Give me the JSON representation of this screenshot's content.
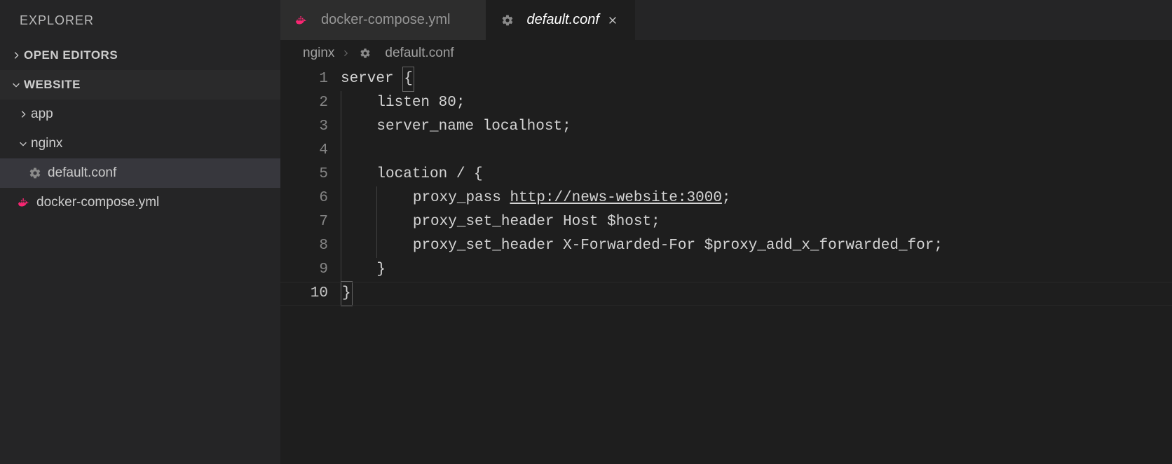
{
  "sidebar": {
    "title": "EXPLORER",
    "open_editors_label": "OPEN EDITORS",
    "project_label": "WEBSITE",
    "tree": {
      "app": {
        "label": "app",
        "expanded": false
      },
      "nginx": {
        "label": "nginx",
        "expanded": true,
        "children": {
          "default_conf": {
            "label": "default.conf",
            "icon": "gear"
          }
        }
      },
      "docker_compose": {
        "label": "docker-compose.yml",
        "icon": "docker"
      }
    }
  },
  "tabs": [
    {
      "label": "docker-compose.yml",
      "icon": "docker",
      "active": false
    },
    {
      "label": "default.conf",
      "icon": "gear",
      "active": true,
      "italic": true
    }
  ],
  "breadcrumbs": {
    "segments": [
      "nginx",
      "default.conf"
    ],
    "icon": "gear"
  },
  "editor": {
    "cursor_line": 10,
    "lines": [
      {
        "n": 1,
        "indent": 0,
        "text": "server ",
        "suffix_box": "{"
      },
      {
        "n": 2,
        "indent": 1,
        "text": "listen 80;"
      },
      {
        "n": 3,
        "indent": 1,
        "text": "server_name localhost;"
      },
      {
        "n": 4,
        "indent": 1,
        "text": ""
      },
      {
        "n": 5,
        "indent": 1,
        "text": "location / {"
      },
      {
        "n": 6,
        "indent": 2,
        "text_pre": "proxy_pass ",
        "link": "http://news-website:3000",
        "text_post": ";"
      },
      {
        "n": 7,
        "indent": 2,
        "text": "proxy_set_header Host $host;"
      },
      {
        "n": 8,
        "indent": 2,
        "text": "proxy_set_header X-Forwarded-For $proxy_add_x_forwarded_for;"
      },
      {
        "n": 9,
        "indent": 1,
        "text": "}"
      },
      {
        "n": 10,
        "indent": 0,
        "prefix_box": "}",
        "text": ""
      }
    ]
  }
}
